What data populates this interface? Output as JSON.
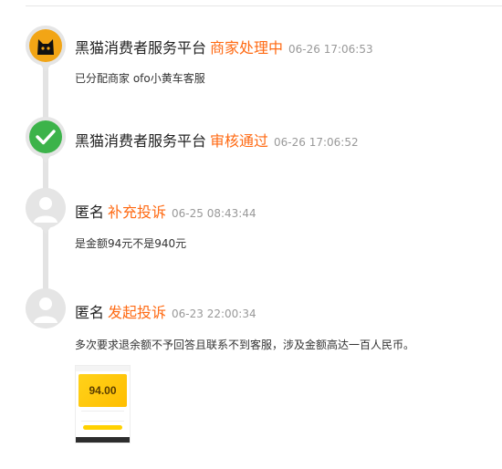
{
  "timeline": {
    "entries": [
      {
        "name": "黑猫消费者服务平台",
        "action": "商家处理中",
        "time": "06-26 17:06:53",
        "content": "已分配商家 ofo小黄车客服",
        "avatar_icon": "black-cat-icon"
      },
      {
        "name": "黑猫消费者服务平台",
        "action": "审核通过",
        "time": "06-26 17:06:52",
        "avatar_icon": "check-circle-icon"
      },
      {
        "name": "匿名",
        "action": "补充投诉",
        "time": "06-25 08:43:44",
        "content": "是金额94元不是940元",
        "avatar_icon": "user-placeholder-icon"
      },
      {
        "name": "匿名",
        "action": "发起投诉",
        "time": "06-23 22:00:34",
        "content": "多次要求退余额不予回答且联系不到客服，涉及金额高达一百人民币。",
        "avatar_icon": "user-placeholder-icon",
        "attachment": {
          "amount": "94.00"
        }
      }
    ]
  },
  "colors": {
    "action": "#ff6a13",
    "time": "#999999",
    "check": "#3cb34a",
    "avatar_bg": "#e5e5e5",
    "cat_bg": "#f2a515"
  }
}
